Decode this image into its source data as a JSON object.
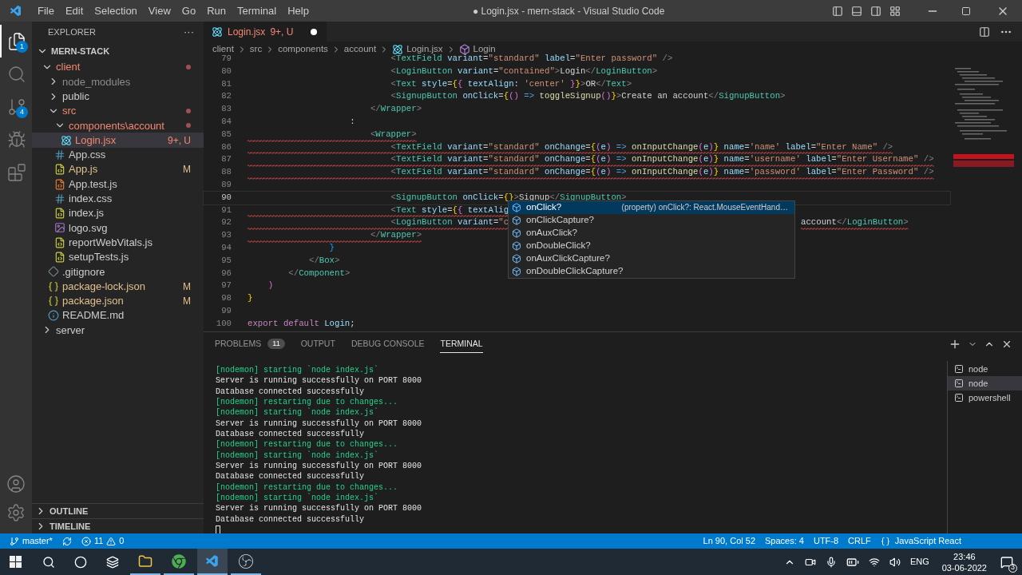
{
  "window": {
    "title": "● Login.jsx - mern-stack - Visual Studio Code",
    "menu": [
      "File",
      "Edit",
      "Selection",
      "View",
      "Go",
      "Run",
      "Terminal",
      "Help"
    ]
  },
  "activity_bar": {
    "top": [
      {
        "kind": "files",
        "badge": "1",
        "selected": true
      },
      {
        "kind": "search",
        "selected": false
      },
      {
        "kind": "source-control",
        "badge": "4",
        "selected": false
      },
      {
        "kind": "debug",
        "selected": false
      },
      {
        "kind": "extensions",
        "selected": false
      }
    ],
    "bottom": [
      {
        "kind": "account"
      },
      {
        "kind": "settings"
      }
    ]
  },
  "sidebar": {
    "title": "EXPLORER",
    "more": "···",
    "root": "MERN-STACK",
    "tree": [
      {
        "label": "client",
        "kind": "folder",
        "expanded": true,
        "has_errors": true,
        "children": [
          {
            "label": "node_modules",
            "kind": "folder",
            "expanded": false,
            "ignored": true
          },
          {
            "label": "public",
            "kind": "folder",
            "expanded": false
          },
          {
            "label": "src",
            "kind": "folder",
            "expanded": true,
            "has_errors": true,
            "children": [
              {
                "label": "components\\account",
                "kind": "folder",
                "expanded": true,
                "has_errors": true,
                "children": [
                  {
                    "label": "Login.jsx",
                    "kind": "react",
                    "has_errors": true,
                    "badge": "9+, U",
                    "selected": true
                  }
                ]
              },
              {
                "label": "App.css",
                "kind": "css",
                "selected": false
              },
              {
                "label": "App.js",
                "kind": "js",
                "modified": true,
                "badge": "M",
                "selected": false
              },
              {
                "label": "App.test.js",
                "kind": "test",
                "selected": false
              },
              {
                "label": "index.css",
                "kind": "css",
                "selected": false
              },
              {
                "label": "index.js",
                "kind": "js",
                "selected": false
              },
              {
                "label": "logo.svg",
                "kind": "svg",
                "selected": false
              },
              {
                "label": "reportWebVitals.js",
                "kind": "js",
                "selected": false
              },
              {
                "label": "setupTests.js",
                "kind": "js",
                "selected": false
              }
            ]
          },
          {
            "label": ".gitignore",
            "kind": "git",
            "selected": false
          },
          {
            "label": "package-lock.json",
            "kind": "json",
            "modified": true,
            "badge": "M",
            "selected": false
          },
          {
            "label": "package.json",
            "kind": "json",
            "modified": true,
            "badge": "M",
            "selected": false
          },
          {
            "label": "README.md",
            "kind": "info",
            "selected": false
          }
        ]
      },
      {
        "label": "server",
        "kind": "folder",
        "expanded": false
      }
    ],
    "sections": [
      {
        "label": "OUTLINE",
        "expanded": false
      },
      {
        "label": "TIMELINE",
        "expanded": false
      }
    ]
  },
  "tab": {
    "label": "Login.jsx",
    "badge": "9+, U",
    "dirty": true
  },
  "breadcrumb": [
    {
      "label": "client",
      "kind": "folder"
    },
    {
      "label": "src",
      "kind": "folder"
    },
    {
      "label": "components",
      "kind": "folder"
    },
    {
      "label": "account",
      "kind": "folder"
    },
    {
      "label": "Login.jsx",
      "kind": "react"
    },
    {
      "label": "Login",
      "kind": "symbol"
    }
  ],
  "code": [
    {
      "number": "79",
      "error": false,
      "current": false,
      "tokens": [
        {
          "kind": "p",
          "text": "                            <"
        },
        {
          "kind": "c",
          "text": "TextField"
        },
        {
          "kind": "a",
          "text": " variant"
        },
        {
          "kind": "t",
          "text": "="
        },
        {
          "kind": "s",
          "text": "\"standard\""
        },
        {
          "kind": "a",
          "text": " label"
        },
        {
          "kind": "t",
          "text": "="
        },
        {
          "kind": "s",
          "text": "\"Enter password\""
        },
        {
          "kind": "p",
          "text": " />"
        }
      ]
    },
    {
      "number": "80",
      "error": false,
      "current": false,
      "tokens": [
        {
          "kind": "p",
          "text": "                            <"
        },
        {
          "kind": "c",
          "text": "LoginButton"
        },
        {
          "kind": "a",
          "text": " variant"
        },
        {
          "kind": "t",
          "text": "="
        },
        {
          "kind": "s",
          "text": "\"contained\""
        },
        {
          "kind": "p",
          "text": ">"
        },
        {
          "kind": "t",
          "text": "Login"
        },
        {
          "kind": "p",
          "text": "</"
        },
        {
          "kind": "c",
          "text": "LoginButton"
        },
        {
          "kind": "p",
          "text": ">"
        }
      ]
    },
    {
      "number": "81",
      "error": false,
      "current": false,
      "tokens": [
        {
          "kind": "p",
          "text": "                            <"
        },
        {
          "kind": "c",
          "text": "Text"
        },
        {
          "kind": "a",
          "text": " style"
        },
        {
          "kind": "t",
          "text": "="
        },
        {
          "kind": "y",
          "text": "{"
        },
        {
          "kind": "m",
          "text": "{"
        },
        {
          "kind": "a",
          "text": " textAlign"
        },
        {
          "kind": "t",
          "text": ":"
        },
        {
          "kind": "s",
          "text": " 'center'"
        },
        {
          "kind": "m",
          "text": " }"
        },
        {
          "kind": "y",
          "text": "}"
        },
        {
          "kind": "p",
          "text": ">"
        },
        {
          "kind": "t",
          "text": "OR"
        },
        {
          "kind": "p",
          "text": "</"
        },
        {
          "kind": "c",
          "text": "Text"
        },
        {
          "kind": "p",
          "text": ">"
        }
      ]
    },
    {
      "number": "82",
      "error": false,
      "current": false,
      "tokens": [
        {
          "kind": "p",
          "text": "                            <"
        },
        {
          "kind": "c",
          "text": "SignupButton"
        },
        {
          "kind": "a",
          "text": " onClick"
        },
        {
          "kind": "t",
          "text": "="
        },
        {
          "kind": "y",
          "text": "{"
        },
        {
          "kind": "m",
          "text": "()"
        },
        {
          "kind": "o",
          "text": " =>"
        },
        {
          "kind": "f",
          "text": " toggleSignup"
        },
        {
          "kind": "m",
          "text": "()"
        },
        {
          "kind": "y",
          "text": "}"
        },
        {
          "kind": "p",
          "text": ">"
        },
        {
          "kind": "t",
          "text": "Create an account"
        },
        {
          "kind": "p",
          "text": "</"
        },
        {
          "kind": "c",
          "text": "SignupButton"
        },
        {
          "kind": "p",
          "text": ">"
        }
      ]
    },
    {
      "number": "83",
      "error": false,
      "current": false,
      "tokens": [
        {
          "kind": "p",
          "text": "                        </"
        },
        {
          "kind": "c",
          "text": "Wrapper"
        },
        {
          "kind": "p",
          "text": ">"
        }
      ]
    },
    {
      "number": "84",
      "error": false,
      "current": false,
      "tokens": [
        {
          "kind": "t",
          "text": "                    :"
        }
      ]
    },
    {
      "number": "85",
      "error": true,
      "current": false,
      "tokens": [
        {
          "kind": "p",
          "text": "                        <"
        },
        {
          "kind": "c",
          "text": "Wrapper"
        },
        {
          "kind": "p",
          "text": ">"
        }
      ]
    },
    {
      "number": "86",
      "error": true,
      "current": false,
      "tokens": [
        {
          "kind": "p",
          "text": "                            <"
        },
        {
          "kind": "c",
          "text": "TextField"
        },
        {
          "kind": "a",
          "text": " variant"
        },
        {
          "kind": "t",
          "text": "="
        },
        {
          "kind": "s",
          "text": "\"standard\""
        },
        {
          "kind": "a",
          "text": " onChange"
        },
        {
          "kind": "t",
          "text": "="
        },
        {
          "kind": "y",
          "text": "{"
        },
        {
          "kind": "m",
          "text": "("
        },
        {
          "kind": "v",
          "text": "e"
        },
        {
          "kind": "m",
          "text": ")"
        },
        {
          "kind": "o",
          "text": " =>"
        },
        {
          "kind": "f",
          "text": " onInputChange"
        },
        {
          "kind": "m",
          "text": "("
        },
        {
          "kind": "v",
          "text": "e"
        },
        {
          "kind": "m",
          "text": ")"
        },
        {
          "kind": "y",
          "text": "}"
        },
        {
          "kind": "a",
          "text": " name"
        },
        {
          "kind": "t",
          "text": "="
        },
        {
          "kind": "s",
          "text": "'name'"
        },
        {
          "kind": "a",
          "text": " label"
        },
        {
          "kind": "t",
          "text": "="
        },
        {
          "kind": "s",
          "text": "\"Enter Name\""
        },
        {
          "kind": "p",
          "text": " />"
        }
      ]
    },
    {
      "number": "87",
      "error": true,
      "current": false,
      "tokens": [
        {
          "kind": "p",
          "text": "                            <"
        },
        {
          "kind": "c",
          "text": "TextField"
        },
        {
          "kind": "a",
          "text": " variant"
        },
        {
          "kind": "t",
          "text": "="
        },
        {
          "kind": "s",
          "text": "\"standard\""
        },
        {
          "kind": "a",
          "text": " onChange"
        },
        {
          "kind": "t",
          "text": "="
        },
        {
          "kind": "y",
          "text": "{"
        },
        {
          "kind": "m",
          "text": "("
        },
        {
          "kind": "v",
          "text": "e"
        },
        {
          "kind": "m",
          "text": ")"
        },
        {
          "kind": "o",
          "text": " =>"
        },
        {
          "kind": "f",
          "text": " onInputChange"
        },
        {
          "kind": "m",
          "text": "("
        },
        {
          "kind": "v",
          "text": "e"
        },
        {
          "kind": "m",
          "text": ")"
        },
        {
          "kind": "y",
          "text": "}"
        },
        {
          "kind": "a",
          "text": " name"
        },
        {
          "kind": "t",
          "text": "="
        },
        {
          "kind": "s",
          "text": "'username'"
        },
        {
          "kind": "a",
          "text": " label"
        },
        {
          "kind": "t",
          "text": "="
        },
        {
          "kind": "s",
          "text": "\"Enter Username\""
        },
        {
          "kind": "p",
          "text": " />"
        }
      ]
    },
    {
      "number": "88",
      "error": true,
      "current": false,
      "tokens": [
        {
          "kind": "p",
          "text": "                            <"
        },
        {
          "kind": "c",
          "text": "TextField"
        },
        {
          "kind": "a",
          "text": " variant"
        },
        {
          "kind": "t",
          "text": "="
        },
        {
          "kind": "s",
          "text": "\"standard\""
        },
        {
          "kind": "a",
          "text": " onChange"
        },
        {
          "kind": "t",
          "text": "="
        },
        {
          "kind": "y",
          "text": "{"
        },
        {
          "kind": "m",
          "text": "("
        },
        {
          "kind": "v",
          "text": "e"
        },
        {
          "kind": "m",
          "text": ")"
        },
        {
          "kind": "o",
          "text": " =>"
        },
        {
          "kind": "f",
          "text": " onInputChange"
        },
        {
          "kind": "m",
          "text": "("
        },
        {
          "kind": "v",
          "text": "e"
        },
        {
          "kind": "m",
          "text": ")"
        },
        {
          "kind": "y",
          "text": "}"
        },
        {
          "kind": "a",
          "text": " name"
        },
        {
          "kind": "t",
          "text": "="
        },
        {
          "kind": "s",
          "text": "'password'"
        },
        {
          "kind": "a",
          "text": " label"
        },
        {
          "kind": "t",
          "text": "="
        },
        {
          "kind": "s",
          "text": "\"Enter Password\""
        },
        {
          "kind": "p",
          "text": " />"
        }
      ]
    },
    {
      "number": "89",
      "current": false
    },
    {
      "number": "90",
      "error": false,
      "current": true,
      "tokens": [
        {
          "kind": "p",
          "text": "                            <"
        },
        {
          "kind": "c",
          "text": "SignupButton"
        },
        {
          "kind": "a",
          "text": " onClick"
        },
        {
          "kind": "t",
          "text": "="
        },
        {
          "kind": "y",
          "text": "{}"
        },
        {
          "kind": "p",
          "text": ">"
        },
        {
          "kind": "t",
          "text": "Signup"
        },
        {
          "kind": "p",
          "text": "</"
        },
        {
          "kind": "c",
          "text": "SignupButton"
        },
        {
          "kind": "p",
          "text": ">"
        }
      ]
    },
    {
      "number": "91",
      "error": true,
      "current": false,
      "tokens": [
        {
          "kind": "p",
          "text": "                            <"
        },
        {
          "kind": "c",
          "text": "Text"
        },
        {
          "kind": "a",
          "text": " style"
        },
        {
          "kind": "t",
          "text": "="
        },
        {
          "kind": "y",
          "text": "{"
        },
        {
          "kind": "m",
          "text": "{"
        },
        {
          "kind": "a",
          "text": " textAlig"
        }
      ]
    },
    {
      "number": "92",
      "error": true,
      "current": false,
      "tokens": [
        {
          "kind": "p",
          "text": "                            <"
        },
        {
          "kind": "c",
          "text": "LoginButton"
        },
        {
          "kind": "a",
          "text": " variant"
        },
        {
          "kind": "t",
          "text": "="
        },
        {
          "kind": "s",
          "text": "\"c"
        }
      ],
      "tail": [
        {
          "kind": "t",
          "text": "account"
        },
        {
          "kind": "p",
          "text": "</"
        },
        {
          "kind": "c",
          "text": "LoginButton"
        },
        {
          "kind": "p",
          "text": ">"
        }
      ]
    },
    {
      "number": "93",
      "error": true,
      "current": false,
      "tokens": [
        {
          "kind": "p",
          "text": "                        </"
        },
        {
          "kind": "c",
          "text": "Wrapper"
        },
        {
          "kind": "p",
          "text": ">"
        }
      ]
    },
    {
      "number": "94",
      "error": false,
      "current": false,
      "tokens": [
        {
          "kind": "b",
          "text": "                }"
        }
      ]
    },
    {
      "number": "95",
      "error": false,
      "current": false,
      "tokens": [
        {
          "kind": "p",
          "text": "            </"
        },
        {
          "kind": "c",
          "text": "Box"
        },
        {
          "kind": "p",
          "text": ">"
        }
      ]
    },
    {
      "number": "96",
      "error": false,
      "current": false,
      "tokens": [
        {
          "kind": "p",
          "text": "        </"
        },
        {
          "kind": "c",
          "text": "Component"
        },
        {
          "kind": "p",
          "text": ">"
        }
      ]
    },
    {
      "number": "97",
      "error": false,
      "current": false,
      "tokens": [
        {
          "kind": "m",
          "text": "    )"
        }
      ]
    },
    {
      "number": "98",
      "error": false,
      "current": false,
      "tokens": [
        {
          "kind": "y",
          "text": "}"
        }
      ]
    },
    {
      "number": "99",
      "current": false
    },
    {
      "number": "100",
      "error": false,
      "current": false,
      "tokens": [
        {
          "kind": "k",
          "text": "export"
        },
        {
          "kind": "k",
          "text": " default"
        },
        {
          "kind": "v",
          "text": " Login"
        },
        {
          "kind": "t",
          "text": ";"
        }
      ]
    }
  ],
  "suggestions": [
    {
      "label": "onClick?",
      "detail": "(property) onClick?: React.MouseEventHand…",
      "selected": true
    },
    {
      "label": "onClickCapture?",
      "selected": false
    },
    {
      "label": "onAuxClick?",
      "selected": false
    },
    {
      "label": "onDoubleClick?",
      "selected": false
    },
    {
      "label": "onAuxClickCapture?",
      "selected": false
    },
    {
      "label": "onDoubleClickCapture?",
      "selected": false
    }
  ],
  "panel": {
    "tabs": [
      {
        "label": "PROBLEMS",
        "count": "11",
        "selected": false
      },
      {
        "label": "OUTPUT",
        "selected": false
      },
      {
        "label": "DEBUG CONSOLE",
        "selected": false
      },
      {
        "label": "TERMINAL",
        "selected": true
      }
    ],
    "terminal": [
      {
        "kind": "nodemon",
        "text": "[nodemon] starting `node index.js`"
      },
      {
        "kind": "out",
        "text": "Server is running successfully on PORT 8000"
      },
      {
        "kind": "out",
        "text": "Database connected successfully"
      },
      {
        "kind": "nodemon",
        "text": "[nodemon] restarting due to changes..."
      },
      {
        "kind": "nodemon",
        "text": "[nodemon] starting `node index.js`"
      },
      {
        "kind": "out",
        "text": "Server is running successfully on PORT 8000"
      },
      {
        "kind": "out",
        "text": "Database connected successfully"
      },
      {
        "kind": "nodemon",
        "text": "[nodemon] restarting due to changes..."
      },
      {
        "kind": "nodemon",
        "text": "[nodemon] starting `node index.js`"
      },
      {
        "kind": "out",
        "text": "Server is running successfully on PORT 8000"
      },
      {
        "kind": "out",
        "text": "Database connected successfully"
      },
      {
        "kind": "nodemon",
        "text": "[nodemon] restarting due to changes..."
      },
      {
        "kind": "nodemon",
        "text": "[nodemon] starting `node index.js`"
      },
      {
        "kind": "out",
        "text": "Server is running successfully on PORT 8000"
      },
      {
        "kind": "out",
        "text": "Database connected successfully"
      }
    ],
    "terminals": [
      {
        "label": "node",
        "selected": false
      },
      {
        "label": "node",
        "selected": true
      },
      {
        "label": "powershell",
        "selected": false
      }
    ]
  },
  "status_bar": {
    "branch": "master*",
    "errors": "11",
    "warnings": "0",
    "right": [
      "Ln 90, Col 52",
      "Spaces: 4",
      "UTF-8",
      "CRLF"
    ],
    "language": "JavaScript React"
  },
  "taskbar": {
    "apps": [
      {
        "kind": "files",
        "active": false
      },
      {
        "kind": "browser",
        "active": false
      },
      {
        "kind": "editor",
        "active": true
      },
      {
        "kind": "recorder",
        "active": false
      }
    ],
    "language": "ENG",
    "time": "23:46",
    "date": "03-06-2022",
    "notifications": "3"
  }
}
